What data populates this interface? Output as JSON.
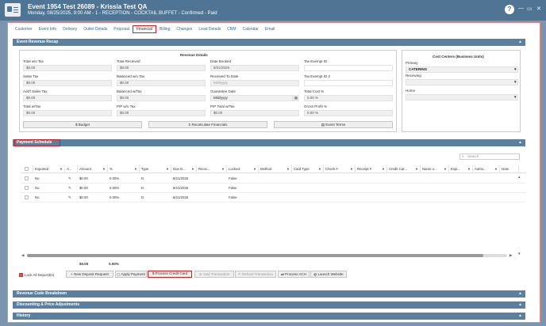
{
  "window": {
    "title": "Event 1954 Test 26089 - Krissia Test QA",
    "subtitle": "Monday, 08/25/2025, 9:00 AM - 1 - RECEPTION - COCKTAIL BUFFET - Confirmed - Paid",
    "help_label": "?",
    "min_label": "—",
    "max_label": "▭",
    "close_label": "✕"
  },
  "tabs": [
    "Customer",
    "Event Info",
    "Delivery",
    "Outlet Details",
    "Proposal",
    "Financial",
    "Billing",
    "Changes",
    "Lead Details",
    "CRM",
    "Calendar",
    "Email"
  ],
  "active_tab": "Financial",
  "recap": {
    "header": "Event Revenue Recap",
    "revenue_title": "Revenue Details",
    "fields": {
      "total_wo_tax": {
        "label": "Total w/o Tax",
        "value": "$0.00"
      },
      "total_received": {
        "label": "Total Received",
        "value": "$0.00"
      },
      "date_booked": {
        "label": "Date Booked",
        "value": "8/21/2025"
      },
      "tax_exempt_id": {
        "label": "Tax Exempt ID",
        "value": ""
      },
      "sales_tax": {
        "label": "Sales Tax",
        "value": "$0.00"
      },
      "balanced_wo_tax": {
        "label": "Balanced w/o Tax",
        "value": "$0.00"
      },
      "received_to_date": {
        "label": "Received To Date",
        "placeholder": "M/d/yyyy"
      },
      "tax_exempt_id2": {
        "label": "Tax Exempt ID 2",
        "value": ""
      },
      "addl_sales_tax": {
        "label": "Add'l Sales Tax",
        "value": "$0.00"
      },
      "balanced_w_tax": {
        "label": "Balanced w/Tax",
        "value": "$0.00"
      },
      "guarantee_date": {
        "label": "Guarantee Date",
        "value": "M/d/yyyy"
      },
      "total_cost_pct": {
        "label": "Total Cost %",
        "value": "0.00 %"
      },
      "total_w_tax": {
        "label": "Total w/Tax",
        "value": "$0.00"
      },
      "pp_wo_tax": {
        "label": "P/P w/o Tax",
        "value": "$0.00"
      },
      "pp_total_w_tax": {
        "label": "P/P Total w/Tax",
        "value": "$0.00"
      },
      "gross_profit_pct": {
        "label": "Gross Profit %",
        "value": "0.00 %"
      }
    },
    "buttons": {
      "budget": "Budget",
      "recalculate": "Recalculate Financials",
      "event_terms": "Event Terms"
    },
    "cost_centers": {
      "title": "Cost Centers (Business Units)",
      "primary_label": "Primary",
      "primary_value": "CATERING",
      "receiving_label": "Receiving",
      "receiving_value": "",
      "home_label": "Home",
      "home_value": ""
    }
  },
  "payment": {
    "header": "Payment Schedule",
    "search_placeholder": "Search",
    "columns": [
      "Exported",
      "A...",
      "Amount",
      "%",
      "Type",
      "Due D...",
      "Recei...",
      "Locked",
      "Method",
      "Card Type",
      "Check #",
      "Receipt #",
      "Credit Car...",
      "Name o...",
      "Expi...",
      "Autho...",
      "Note"
    ],
    "rows": [
      {
        "exported": "No",
        "amount": "$0.00",
        "pct": "0.00%",
        "type": "D",
        "due": "8/21/2025",
        "locked": "False"
      },
      {
        "exported": "No",
        "amount": "$0.00",
        "pct": "0.00%",
        "type": "D",
        "due": "8/21/2025",
        "locked": "False"
      },
      {
        "exported": "No",
        "amount": "$0.00",
        "pct": "0.00%",
        "type": "D",
        "due": "8/21/2025",
        "locked": "False"
      }
    ],
    "totals": {
      "amount": "$0.00",
      "pct": "0.00%"
    },
    "lock_label": "Lock All Deposit(s)",
    "actions": {
      "new_deposit": "New Deposit Request",
      "apply_payment": "Apply Payment",
      "process_cc": "Process Credit Card",
      "void": "Void Transaction",
      "refund": "Refund Transaction",
      "process_ach": "Process ACH",
      "launch_website": "Launch Website"
    }
  },
  "sections": {
    "revenue_code": "Revenue Code Breakdown",
    "discounting": "Discounting & Price Adjustments",
    "history": "History"
  },
  "colors": {
    "header_blue": "#5b7f9e",
    "titlebar": "#4f7494",
    "highlight": "#d01f1f",
    "link": "#2a6aa8"
  }
}
